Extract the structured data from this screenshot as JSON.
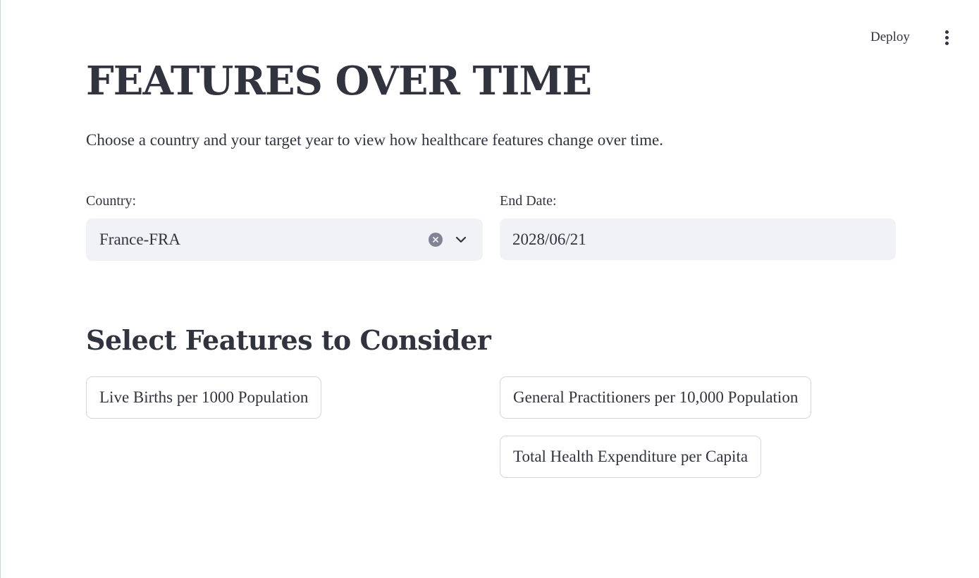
{
  "header": {
    "deploy_label": "Deploy",
    "menu_icon": "kebab-menu-icon"
  },
  "page": {
    "title": "FEATURES OVER TIME",
    "subtitle": "Choose a country and your target year to view how healthcare features change over time."
  },
  "country": {
    "label": "Country:",
    "value": "France-FRA",
    "icons": [
      "clear-icon",
      "chevron-down-icon"
    ]
  },
  "end_date": {
    "label": "End Date:",
    "value": "2028/06/21"
  },
  "features": {
    "heading": "Select Features to Consider",
    "items": [
      "Live Births per 1000 Population",
      "General Practitioners per 10,000 Population",
      "Total Health Expenditure per Capita"
    ]
  },
  "colors": {
    "text": "#31333f",
    "input_bg": "#f0f2f6",
    "button_border": "#d4d6dc",
    "icon_gray": "#808495"
  }
}
